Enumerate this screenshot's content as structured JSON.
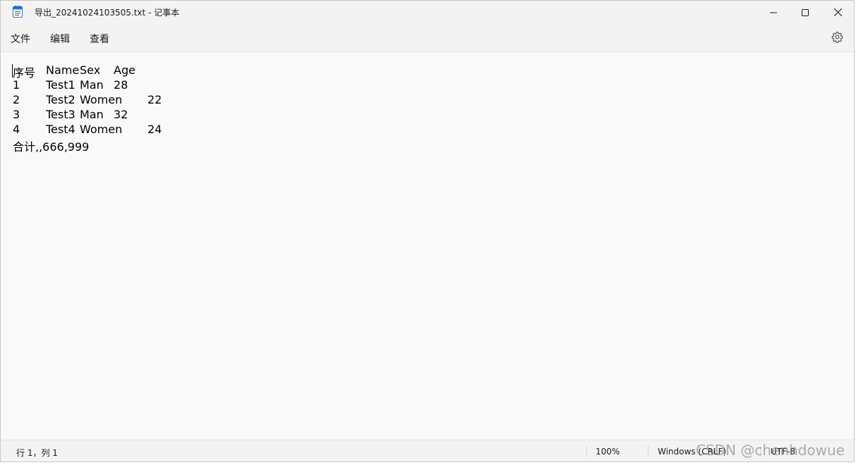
{
  "window": {
    "title": "导出_20241024103505.txt - 记事本",
    "app_icon": "notepad-icon"
  },
  "title_buttons": {
    "minimize_icon": "minimize-icon",
    "maximize_icon": "maximize-icon",
    "close_icon": "close-icon"
  },
  "menu": {
    "file": "文件",
    "edit": "编辑",
    "view": "查看",
    "settings_icon": "gear-icon"
  },
  "document": {
    "header": [
      "序号",
      "Name",
      "Sex",
      "Age"
    ],
    "rows": [
      [
        "1",
        "Test1",
        "Man",
        "28"
      ],
      [
        "2",
        "Test2",
        "Women",
        "22"
      ],
      [
        "3",
        "Test3",
        "Man",
        "32"
      ],
      [
        "4",
        "Test4",
        "Women",
        "24"
      ]
    ],
    "footer": "合计,,666,999"
  },
  "status": {
    "position": "行 1，列 1",
    "zoom": "100%",
    "line_ending": "Windows (CRLF)",
    "encoding": "UTF-8"
  },
  "watermark": "CSDN @chenhdowue",
  "colors": {
    "window_bg": "#f3f3f3",
    "editor_bg": "#f9f9f9",
    "text": "#000000"
  }
}
